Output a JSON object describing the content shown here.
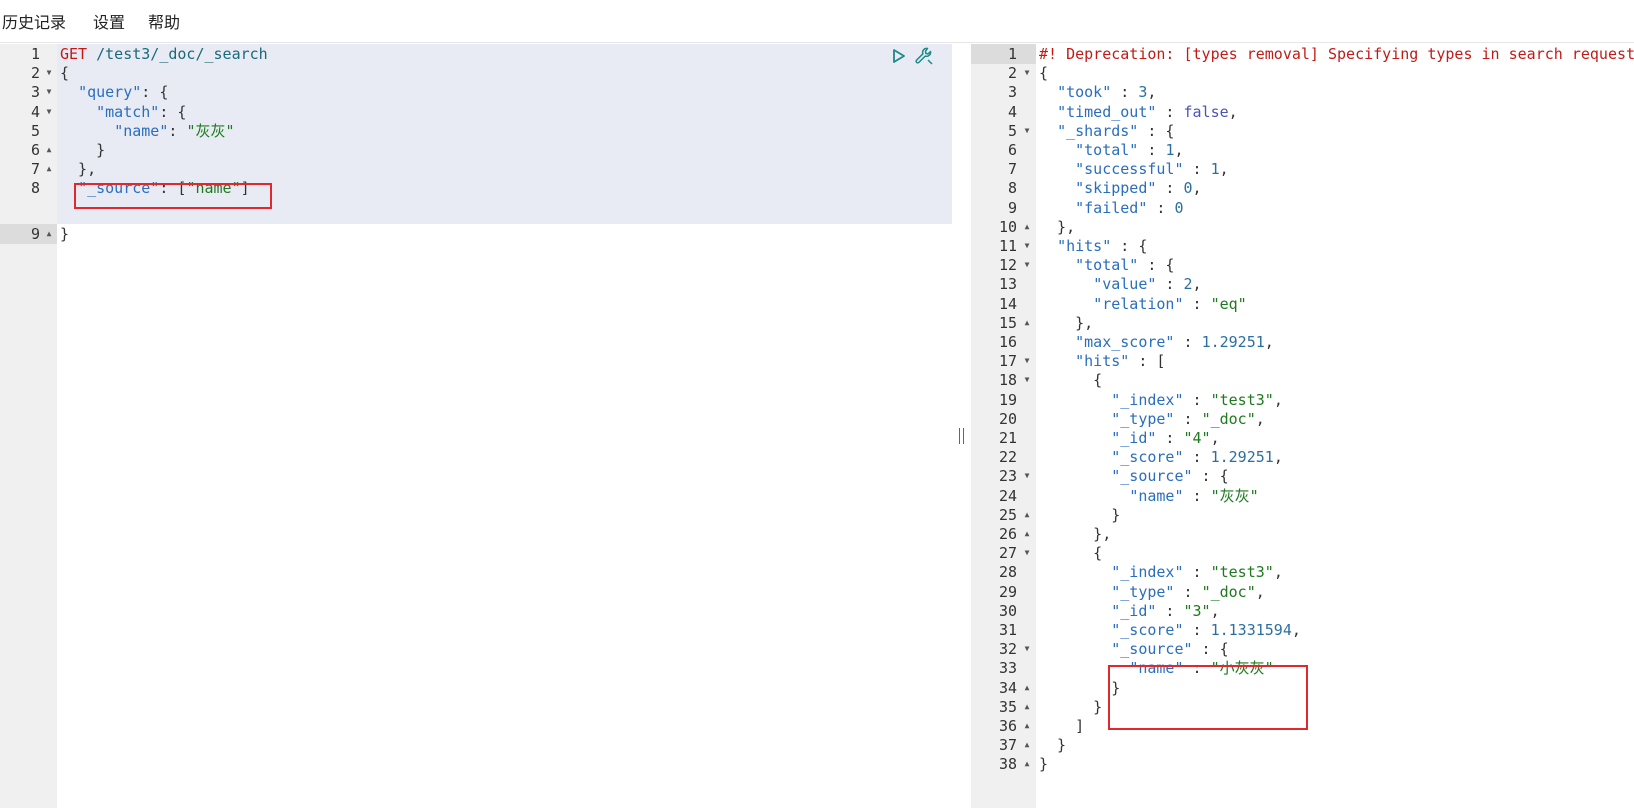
{
  "menu": {
    "items": [
      "历史记录",
      "设置",
      "帮助"
    ]
  },
  "request_editor": {
    "lines": [
      {
        "n": "1",
        "fold": "",
        "segs": [
          {
            "t": "GET",
            "c": "s-meth"
          },
          {
            "t": " /test3/_doc/_search",
            "c": "s-url"
          }
        ]
      },
      {
        "n": "2",
        "fold": "▼",
        "segs": [
          {
            "t": "{",
            "c": ""
          }
        ]
      },
      {
        "n": "3",
        "fold": "▼",
        "segs": [
          {
            "t": "  ",
            "c": ""
          },
          {
            "t": "\"query\"",
            "c": "s-key"
          },
          {
            "t": ": {",
            "c": ""
          }
        ]
      },
      {
        "n": "4",
        "fold": "▼",
        "segs": [
          {
            "t": "    ",
            "c": ""
          },
          {
            "t": "\"match\"",
            "c": "s-key"
          },
          {
            "t": ": {",
            "c": ""
          }
        ]
      },
      {
        "n": "5",
        "fold": "",
        "segs": [
          {
            "t": "      ",
            "c": ""
          },
          {
            "t": "\"name\"",
            "c": "s-key"
          },
          {
            "t": ": ",
            "c": ""
          },
          {
            "t": "\"灰灰\"",
            "c": "s-str"
          }
        ]
      },
      {
        "n": "6",
        "fold": "▲",
        "segs": [
          {
            "t": "    }",
            "c": ""
          }
        ]
      },
      {
        "n": "7",
        "fold": "▲",
        "segs": [
          {
            "t": "  },",
            "c": ""
          }
        ]
      },
      {
        "n": "8",
        "fold": "",
        "segs": [
          {
            "t": "  ",
            "c": ""
          },
          {
            "t": "\"_source\"",
            "c": "s-key"
          },
          {
            "t": ": [",
            "c": ""
          },
          {
            "t": "\"name\"",
            "c": "s-str"
          },
          {
            "t": "]",
            "c": ""
          }
        ]
      },
      {
        "n": "9",
        "fold": "▲",
        "segs": [
          {
            "t": "}",
            "c": ""
          }
        ]
      }
    ]
  },
  "response_editor": {
    "lines": [
      {
        "n": "1",
        "fold": "",
        "segs": [
          {
            "t": "#! Deprecation: [types removal] Specifying types in search requests is deprecated.",
            "c": "s-warn"
          }
        ]
      },
      {
        "n": "2",
        "fold": "▼",
        "segs": [
          {
            "t": "{",
            "c": ""
          }
        ]
      },
      {
        "n": "3",
        "fold": "",
        "segs": [
          {
            "t": "  ",
            "c": ""
          },
          {
            "t": "\"took\"",
            "c": "s-key"
          },
          {
            "t": " : ",
            "c": ""
          },
          {
            "t": "3",
            "c": "s-num"
          },
          {
            "t": ",",
            "c": ""
          }
        ]
      },
      {
        "n": "4",
        "fold": "",
        "segs": [
          {
            "t": "  ",
            "c": ""
          },
          {
            "t": "\"timed_out\"",
            "c": "s-key"
          },
          {
            "t": " : ",
            "c": ""
          },
          {
            "t": "false",
            "c": "s-bool"
          },
          {
            "t": ",",
            "c": ""
          }
        ]
      },
      {
        "n": "5",
        "fold": "▼",
        "segs": [
          {
            "t": "  ",
            "c": ""
          },
          {
            "t": "\"_shards\"",
            "c": "s-key"
          },
          {
            "t": " : {",
            "c": ""
          }
        ]
      },
      {
        "n": "6",
        "fold": "",
        "segs": [
          {
            "t": "    ",
            "c": ""
          },
          {
            "t": "\"total\"",
            "c": "s-key"
          },
          {
            "t": " : ",
            "c": ""
          },
          {
            "t": "1",
            "c": "s-num"
          },
          {
            "t": ",",
            "c": ""
          }
        ]
      },
      {
        "n": "7",
        "fold": "",
        "segs": [
          {
            "t": "    ",
            "c": ""
          },
          {
            "t": "\"successful\"",
            "c": "s-key"
          },
          {
            "t": " : ",
            "c": ""
          },
          {
            "t": "1",
            "c": "s-num"
          },
          {
            "t": ",",
            "c": ""
          }
        ]
      },
      {
        "n": "8",
        "fold": "",
        "segs": [
          {
            "t": "    ",
            "c": ""
          },
          {
            "t": "\"skipped\"",
            "c": "s-key"
          },
          {
            "t": " : ",
            "c": ""
          },
          {
            "t": "0",
            "c": "s-num"
          },
          {
            "t": ",",
            "c": ""
          }
        ]
      },
      {
        "n": "9",
        "fold": "",
        "segs": [
          {
            "t": "    ",
            "c": ""
          },
          {
            "t": "\"failed\"",
            "c": "s-key"
          },
          {
            "t": " : ",
            "c": ""
          },
          {
            "t": "0",
            "c": "s-num"
          }
        ]
      },
      {
        "n": "10",
        "fold": "▲",
        "segs": [
          {
            "t": "  },",
            "c": ""
          }
        ]
      },
      {
        "n": "11",
        "fold": "▼",
        "segs": [
          {
            "t": "  ",
            "c": ""
          },
          {
            "t": "\"hits\"",
            "c": "s-key"
          },
          {
            "t": " : {",
            "c": ""
          }
        ]
      },
      {
        "n": "12",
        "fold": "▼",
        "segs": [
          {
            "t": "    ",
            "c": ""
          },
          {
            "t": "\"total\"",
            "c": "s-key"
          },
          {
            "t": " : {",
            "c": ""
          }
        ]
      },
      {
        "n": "13",
        "fold": "",
        "segs": [
          {
            "t": "      ",
            "c": ""
          },
          {
            "t": "\"value\"",
            "c": "s-key"
          },
          {
            "t": " : ",
            "c": ""
          },
          {
            "t": "2",
            "c": "s-num"
          },
          {
            "t": ",",
            "c": ""
          }
        ]
      },
      {
        "n": "14",
        "fold": "",
        "segs": [
          {
            "t": "      ",
            "c": ""
          },
          {
            "t": "\"relation\"",
            "c": "s-key"
          },
          {
            "t": " : ",
            "c": ""
          },
          {
            "t": "\"eq\"",
            "c": "s-str"
          }
        ]
      },
      {
        "n": "15",
        "fold": "▲",
        "segs": [
          {
            "t": "    },",
            "c": ""
          }
        ]
      },
      {
        "n": "16",
        "fold": "",
        "segs": [
          {
            "t": "    ",
            "c": ""
          },
          {
            "t": "\"max_score\"",
            "c": "s-key"
          },
          {
            "t": " : ",
            "c": ""
          },
          {
            "t": "1.29251",
            "c": "s-num"
          },
          {
            "t": ",",
            "c": ""
          }
        ]
      },
      {
        "n": "17",
        "fold": "▼",
        "segs": [
          {
            "t": "    ",
            "c": ""
          },
          {
            "t": "\"hits\"",
            "c": "s-key"
          },
          {
            "t": " : [",
            "c": ""
          }
        ]
      },
      {
        "n": "18",
        "fold": "▼",
        "segs": [
          {
            "t": "      {",
            "c": ""
          }
        ]
      },
      {
        "n": "19",
        "fold": "",
        "segs": [
          {
            "t": "        ",
            "c": ""
          },
          {
            "t": "\"_index\"",
            "c": "s-key"
          },
          {
            "t": " : ",
            "c": ""
          },
          {
            "t": "\"test3\"",
            "c": "s-str"
          },
          {
            "t": ",",
            "c": ""
          }
        ]
      },
      {
        "n": "20",
        "fold": "",
        "segs": [
          {
            "t": "        ",
            "c": ""
          },
          {
            "t": "\"_type\"",
            "c": "s-key"
          },
          {
            "t": " : ",
            "c": ""
          },
          {
            "t": "\"_doc\"",
            "c": "s-str"
          },
          {
            "t": ",",
            "c": ""
          }
        ]
      },
      {
        "n": "21",
        "fold": "",
        "segs": [
          {
            "t": "        ",
            "c": ""
          },
          {
            "t": "\"_id\"",
            "c": "s-key"
          },
          {
            "t": " : ",
            "c": ""
          },
          {
            "t": "\"4\"",
            "c": "s-str"
          },
          {
            "t": ",",
            "c": ""
          }
        ]
      },
      {
        "n": "22",
        "fold": "",
        "segs": [
          {
            "t": "        ",
            "c": ""
          },
          {
            "t": "\"_score\"",
            "c": "s-key"
          },
          {
            "t": " : ",
            "c": ""
          },
          {
            "t": "1.29251",
            "c": "s-num"
          },
          {
            "t": ",",
            "c": ""
          }
        ]
      },
      {
        "n": "23",
        "fold": "▼",
        "segs": [
          {
            "t": "        ",
            "c": ""
          },
          {
            "t": "\"_source\"",
            "c": "s-key"
          },
          {
            "t": " : {",
            "c": ""
          }
        ]
      },
      {
        "n": "24",
        "fold": "",
        "segs": [
          {
            "t": "          ",
            "c": ""
          },
          {
            "t": "\"name\"",
            "c": "s-key"
          },
          {
            "t": " : ",
            "c": ""
          },
          {
            "t": "\"灰灰\"",
            "c": "s-str"
          }
        ]
      },
      {
        "n": "25",
        "fold": "▲",
        "segs": [
          {
            "t": "        }",
            "c": ""
          }
        ]
      },
      {
        "n": "26",
        "fold": "▲",
        "segs": [
          {
            "t": "      },",
            "c": ""
          }
        ]
      },
      {
        "n": "27",
        "fold": "▼",
        "segs": [
          {
            "t": "      {",
            "c": ""
          }
        ]
      },
      {
        "n": "28",
        "fold": "",
        "segs": [
          {
            "t": "        ",
            "c": ""
          },
          {
            "t": "\"_index\"",
            "c": "s-key"
          },
          {
            "t": " : ",
            "c": ""
          },
          {
            "t": "\"test3\"",
            "c": "s-str"
          },
          {
            "t": ",",
            "c": ""
          }
        ]
      },
      {
        "n": "29",
        "fold": "",
        "segs": [
          {
            "t": "        ",
            "c": ""
          },
          {
            "t": "\"_type\"",
            "c": "s-key"
          },
          {
            "t": " : ",
            "c": ""
          },
          {
            "t": "\"_doc\"",
            "c": "s-str"
          },
          {
            "t": ",",
            "c": ""
          }
        ]
      },
      {
        "n": "30",
        "fold": "",
        "segs": [
          {
            "t": "        ",
            "c": ""
          },
          {
            "t": "\"_id\"",
            "c": "s-key"
          },
          {
            "t": " : ",
            "c": ""
          },
          {
            "t": "\"3\"",
            "c": "s-str"
          },
          {
            "t": ",",
            "c": ""
          }
        ]
      },
      {
        "n": "31",
        "fold": "",
        "segs": [
          {
            "t": "        ",
            "c": ""
          },
          {
            "t": "\"_score\"",
            "c": "s-key"
          },
          {
            "t": " : ",
            "c": ""
          },
          {
            "t": "1.1331594",
            "c": "s-num"
          },
          {
            "t": ",",
            "c": ""
          }
        ]
      },
      {
        "n": "32",
        "fold": "▼",
        "segs": [
          {
            "t": "        ",
            "c": ""
          },
          {
            "t": "\"_source\"",
            "c": "s-key"
          },
          {
            "t": " : {",
            "c": ""
          }
        ]
      },
      {
        "n": "33",
        "fold": "",
        "segs": [
          {
            "t": "          ",
            "c": ""
          },
          {
            "t": "\"name\"",
            "c": "s-key"
          },
          {
            "t": " : ",
            "c": ""
          },
          {
            "t": "\"小灰灰\"",
            "c": "s-str"
          }
        ]
      },
      {
        "n": "34",
        "fold": "▲",
        "segs": [
          {
            "t": "        }",
            "c": ""
          }
        ]
      },
      {
        "n": "35",
        "fold": "▲",
        "segs": [
          {
            "t": "      }",
            "c": ""
          }
        ]
      },
      {
        "n": "36",
        "fold": "▲",
        "segs": [
          {
            "t": "    ]",
            "c": ""
          }
        ]
      },
      {
        "n": "37",
        "fold": "▲",
        "segs": [
          {
            "t": "  }",
            "c": ""
          }
        ]
      },
      {
        "n": "38",
        "fold": "▲",
        "segs": [
          {
            "t": "}",
            "c": ""
          }
        ]
      }
    ]
  },
  "icons": {
    "run": "play-icon",
    "settings": "wrench-icon",
    "splitter": "resize-grip-icon"
  },
  "colors": {
    "annotation": "#e0282e",
    "method": "#c41a16",
    "json_key": "#2a6ebe",
    "json_string": "#1f7a1f",
    "run_icon": "#1b8a8a"
  }
}
